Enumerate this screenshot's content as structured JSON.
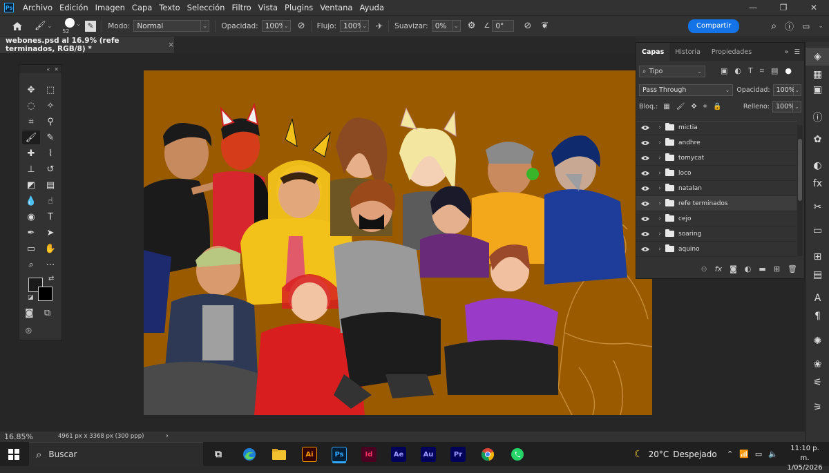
{
  "menu": {
    "items": [
      "Archivo",
      "Edición",
      "Imagen",
      "Capa",
      "Texto",
      "Selección",
      "Filtro",
      "Vista",
      "Plugins",
      "Ventana",
      "Ayuda"
    ],
    "logo": "Ps"
  },
  "options": {
    "brush_size": "52",
    "mode_label": "Modo:",
    "mode_value": "Normal",
    "opacity_label": "Opacidad:",
    "opacity_value": "100%",
    "flow_label": "Flujo:",
    "flow_value": "100%",
    "smoothing_label": "Suavizar:",
    "smoothing_value": "0%",
    "angle_value": "0°",
    "share_label": "Compartir"
  },
  "document": {
    "tab_title": "webones.psd al 16.9% (refe terminados, RGB/8) *",
    "close": "×"
  },
  "status": {
    "zoom": "16.85%",
    "dimensions": "4961 px x 3368 px (300 ppp)",
    "arrow": "›"
  },
  "layers_panel": {
    "tabs": [
      "Capas",
      "Historia",
      "Propiedades"
    ],
    "active_tab": "Capas",
    "filter_value": "Tipo",
    "blend_mode": "Pass Through",
    "opacity_label": "Opacidad:",
    "opacity_value": "100%",
    "lock_label": "Bloq.:",
    "fill_label": "Relleno:",
    "fill_value": "100%",
    "layers": [
      {
        "name": "mictia",
        "selected": false
      },
      {
        "name": "andhre",
        "selected": false
      },
      {
        "name": "tomycat",
        "selected": false
      },
      {
        "name": "loco",
        "selected": false
      },
      {
        "name": "natalan",
        "selected": false
      },
      {
        "name": "refe terminados",
        "selected": true
      },
      {
        "name": "cejo",
        "selected": false
      },
      {
        "name": "soaring",
        "selected": false
      },
      {
        "name": "aquino",
        "selected": false
      }
    ],
    "footer_fx": "fx"
  },
  "taskbar": {
    "search_placeholder": "Buscar",
    "weather_temp": "20°C",
    "weather_desc": "Despejado",
    "time": "11:10 p. m.",
    "date": "1/05/2026",
    "apps": [
      {
        "label": "Ai",
        "color": "#ff9a00",
        "bg": "#330000"
      },
      {
        "label": "Ps",
        "color": "#31a8ff",
        "bg": "#001e36"
      },
      {
        "label": "Id",
        "color": "#ff3366",
        "bg": "#49021f"
      },
      {
        "label": "Ae",
        "color": "#9999ff",
        "bg": "#00005b"
      },
      {
        "label": "Au",
        "color": "#9999ff",
        "bg": "#00005b"
      },
      {
        "label": "Pr",
        "color": "#9999ff",
        "bg": "#00005b"
      }
    ]
  },
  "colors": {
    "accent": "#1473e6",
    "canvas_bg": "#9a5b00"
  }
}
